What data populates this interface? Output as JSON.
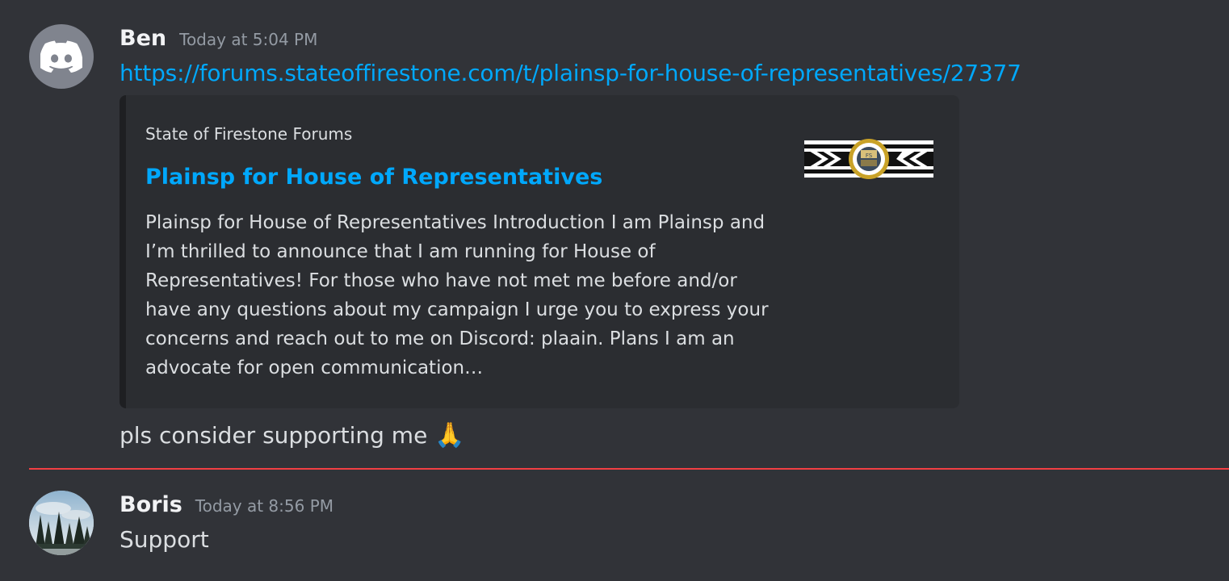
{
  "messages": [
    {
      "author": "Ben",
      "timestamp": "Today at 5:04 PM",
      "link": "https://forums.stateoffirestone.com/t/plainsp-for-house-of-representatives/27377",
      "embed": {
        "provider": "State of Firestone Forums",
        "title": "Plainsp for House of Representatives",
        "description": "Plainsp for House of Representatives Introduction I am Plainsp and I’m thrilled to announce that I am running for House of Representatives! For those who have not met me before and/or have any questions about my campaign I urge you to express your concerns and reach out to me on Discord: plaain. Plans I am an advocate for open communication…",
        "thumbnail_icon": "state-seal-banner"
      },
      "text": "pls consider supporting me",
      "emoji": "🙏",
      "avatar_icon": "discord-logo-icon"
    },
    {
      "author": "Boris",
      "timestamp": "Today at 8:56 PM",
      "text": "Support",
      "avatar_icon": "landscape-photo"
    }
  ],
  "colors": {
    "background": "#313338",
    "link": "#00a8fc",
    "embed_bg": "#2b2d31",
    "new_divider": "#f23f43"
  }
}
